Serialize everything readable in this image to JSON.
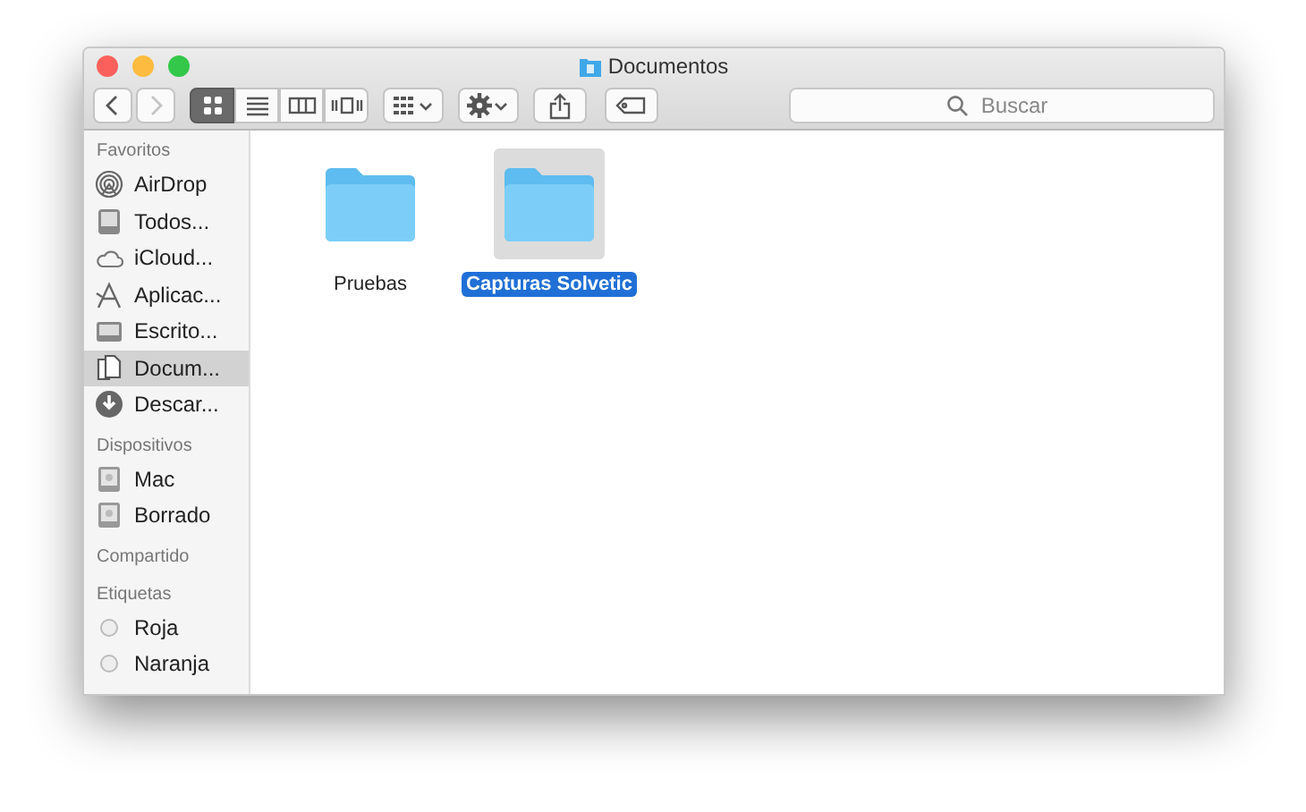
{
  "window": {
    "title": "Documentos"
  },
  "toolbar": {
    "back": {
      "disabled": false
    },
    "forward": {
      "disabled": true
    },
    "views": [
      {
        "kind": "icons",
        "selected": true
      },
      {
        "kind": "list",
        "selected": false
      },
      {
        "kind": "columns",
        "selected": false
      },
      {
        "kind": "coverflow",
        "selected": false
      }
    ],
    "search": {
      "placeholder": "Buscar"
    }
  },
  "sidebar": {
    "sections": [
      {
        "title": "Favoritos",
        "items": [
          {
            "kind": "airdrop",
            "label": "AirDrop",
            "selected": false
          },
          {
            "kind": "allfiles",
            "label": "Todos...",
            "selected": false
          },
          {
            "kind": "cloud",
            "label": "iCloud...",
            "selected": false
          },
          {
            "kind": "apps",
            "label": "Aplicac...",
            "selected": false
          },
          {
            "kind": "desktop",
            "label": "Escrito...",
            "selected": false
          },
          {
            "kind": "documents",
            "label": "Docum...",
            "selected": true
          },
          {
            "kind": "downloads",
            "label": "Descar...",
            "selected": false
          }
        ]
      },
      {
        "title": "Dispositivos",
        "items": [
          {
            "kind": "disk",
            "label": "Mac",
            "selected": false
          },
          {
            "kind": "disk",
            "label": "Borrado",
            "selected": false
          }
        ]
      },
      {
        "title": "Compartido"
      },
      {
        "title": "Etiquetas",
        "items": [
          {
            "kind": "tag",
            "label": "Roja",
            "selected": false
          },
          {
            "kind": "tag",
            "label": "Naranja",
            "selected": false
          }
        ]
      }
    ]
  },
  "files": [
    {
      "name": "Pruebas",
      "selected": false
    },
    {
      "name": "Capturas Solvetic",
      "selected": true
    }
  ]
}
